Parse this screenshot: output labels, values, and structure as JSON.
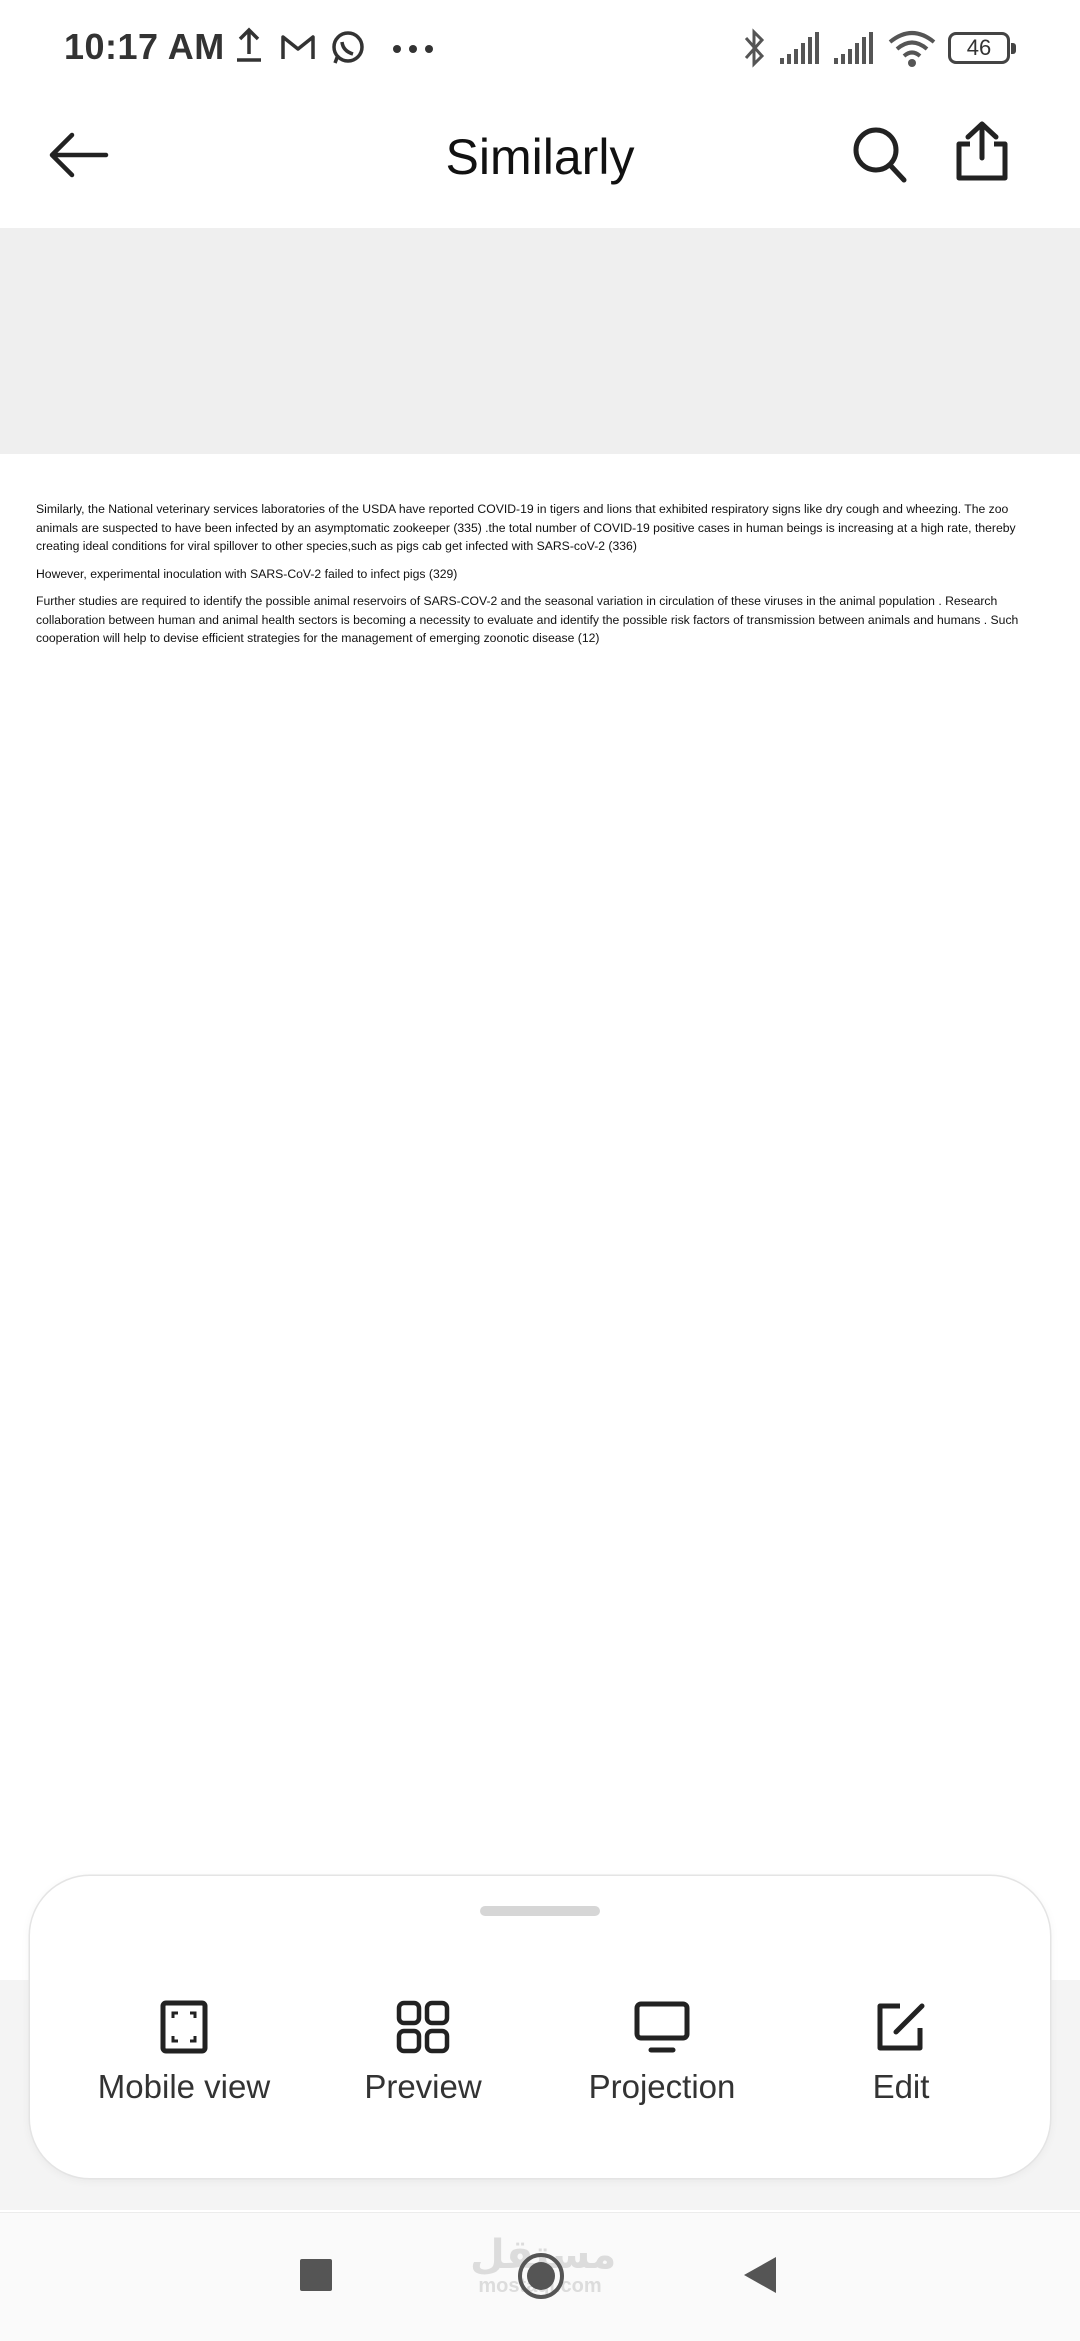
{
  "status_bar": {
    "time": "10:17 AM",
    "battery": "46",
    "icons": [
      "upload-icon",
      "gmail-icon",
      "whatsapp-icon",
      "more-dots-icon",
      "bluetooth-icon",
      "signal-icon",
      "signal-icon",
      "wifi-icon",
      "battery-icon"
    ]
  },
  "app_bar": {
    "title": "Similarly",
    "icons": [
      "back-arrow-icon",
      "search-icon",
      "share-icon"
    ]
  },
  "document": {
    "paragraphs": [
      "Similarly, the National veterinary services laboratories of the USDA have reported COVID-19 in tigers and lions that exhibited respiratory signs like dry cough and wheezing. The zoo animals are suspected to have been infected by an asymptomatic zookeeper (335) .the total number of COVID-19 positive cases in human beings is increasing at a high rate, thereby creating ideal conditions for viral spillover to other species,such as pigs cab get infected with SARS-coV-2 (336)",
      "However, experimental inoculation with SARS-CoV-2 failed to infect pigs (329)",
      "Further studies are required to identify the possible animal reservoirs of SARS-COV-2 and the seasonal variation in circulation of these viruses in the animal population . Research collaboration between human and animal health sectors is becoming a necessity to evaluate and identify the possible risk factors of transmission between animals and humans . Such cooperation will help to devise efficient strategies for the management of emerging zoonotic disease (12)"
    ]
  },
  "bottom_sheet": {
    "actions": [
      {
        "label": "Mobile view",
        "icon": "mobile-view-icon"
      },
      {
        "label": "Preview",
        "icon": "grid-icon"
      },
      {
        "label": "Projection",
        "icon": "monitor-icon"
      },
      {
        "label": "Edit",
        "icon": "edit-icon"
      }
    ]
  },
  "nav_bar": {
    "icons": [
      "recents-square-icon",
      "home-circle-icon",
      "back-triangle-icon"
    ],
    "watermark_arabic": "مستقل",
    "watermark_latin": "mostaql.com"
  }
}
